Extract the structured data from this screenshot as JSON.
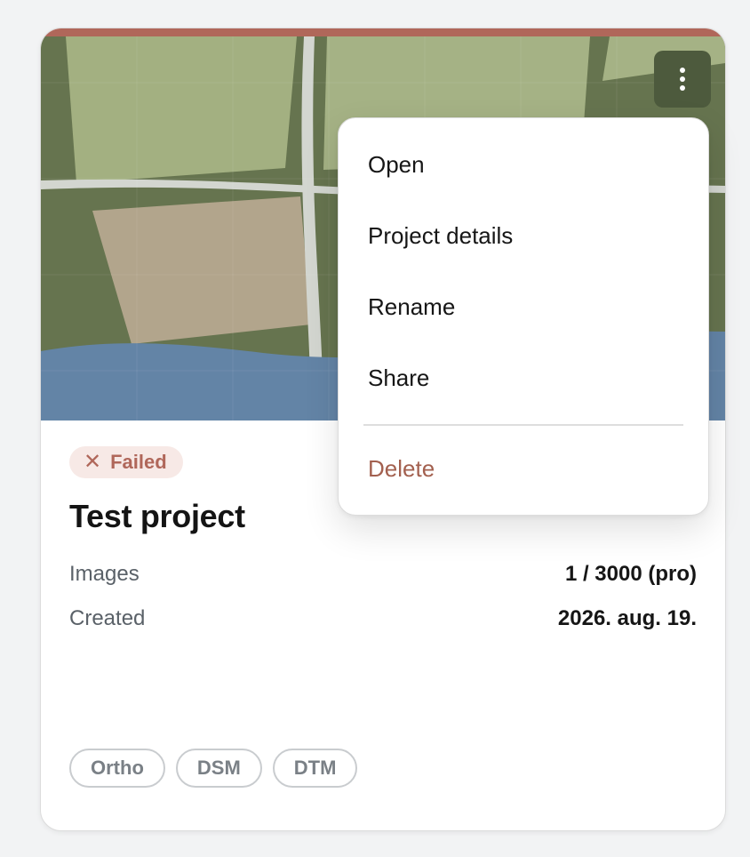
{
  "card": {
    "status_badge": {
      "icon": "x-icon",
      "label": "Failed",
      "color": "#b0675a"
    },
    "title": "Test project",
    "meta": [
      {
        "label": "Images",
        "value": "1 / 3000 (pro)"
      },
      {
        "label": "Created",
        "value": "2026. aug. 19."
      }
    ],
    "chips": [
      "Ortho",
      "DSM",
      "DTM"
    ]
  },
  "menu_button": {
    "icon": "vertical-dots-icon"
  },
  "context_menu": {
    "items": [
      "Open",
      "Project details",
      "Rename",
      "Share"
    ],
    "danger_item": "Delete"
  },
  "colors": {
    "accent_failed": "#b0675a",
    "danger_text": "#a3604f",
    "map_field_dark": "#66744f",
    "map_water": "#6384a6"
  }
}
